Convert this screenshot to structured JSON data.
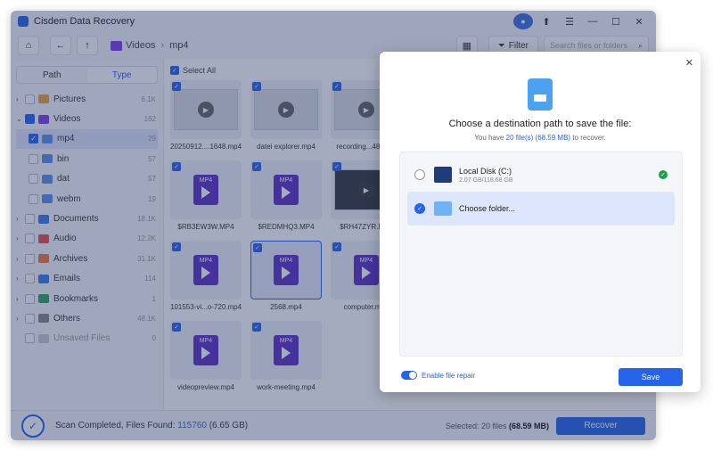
{
  "app": {
    "title": "Cisdem Data Recovery"
  },
  "toolbar": {
    "breadcrumb": [
      "Videos",
      "mp4"
    ],
    "filter_label": "Filter",
    "search_placeholder": "Search files or folders"
  },
  "sidebar": {
    "tabs": [
      "Path",
      "Type"
    ],
    "active_tab": "Type",
    "items": [
      {
        "label": "Pictures",
        "count": "6.1K",
        "color": "#e8a33a"
      },
      {
        "label": "Videos",
        "count": "162",
        "color": "#7b3fe4"
      },
      {
        "label": "mp4",
        "count": "29",
        "color": "#5a8fe8"
      },
      {
        "label": "bin",
        "count": "57",
        "color": "#5a8fe8"
      },
      {
        "label": "dat",
        "count": "57",
        "color": "#5a8fe8"
      },
      {
        "label": "webm",
        "count": "19",
        "color": "#5a8fe8"
      },
      {
        "label": "Documents",
        "count": "18.1K",
        "color": "#3a7be8"
      },
      {
        "label": "Audio",
        "count": "12.2K",
        "color": "#e84a4a"
      },
      {
        "label": "Archives",
        "count": "31.1K",
        "color": "#e87a3a"
      },
      {
        "label": "Emails",
        "count": "114",
        "color": "#3a7be8"
      },
      {
        "label": "Bookmarks",
        "count": "1",
        "color": "#2ca36b"
      },
      {
        "label": "Others",
        "count": "48.1K",
        "color": "#888888"
      },
      {
        "label": "Unsaved Files",
        "count": "0",
        "color": "#cccccc"
      }
    ]
  },
  "grid": {
    "select_all_label": "Select All",
    "tiles": [
      "20250912....1648.mp4",
      "datei explorer.mp4",
      "recording...48-40...",
      "$RB3EW3W.MP4",
      "$REDMHQ3.MP4",
      "$RH47ZYR.MP4",
      "101553-vi...o-720.mp4",
      "2568.mp4",
      "computer.mp4",
      "videopreview.mp4",
      "work-meeting.mp4"
    ]
  },
  "status": {
    "text_prefix": "Scan Completed, Files Found:",
    "files_found": "115760",
    "size": "(6.65 GB)",
    "selected_prefix": "Selected: 20 files",
    "selected_size": "(68.59 MB)",
    "recover_label": "Recover"
  },
  "dialog": {
    "title": "Choose a destination path to save the file:",
    "sub_prefix": "You have",
    "sub_files": "20 file(s) (68.59 MB)",
    "sub_suffix": "to recover.",
    "destinations": [
      {
        "name": "Local Disk (C:)",
        "size": "2.07 GB/118.68 GB"
      },
      {
        "name": "Choose folder...",
        "size": ""
      }
    ],
    "repair_label": "Enable file repair",
    "save_label": "Save"
  }
}
